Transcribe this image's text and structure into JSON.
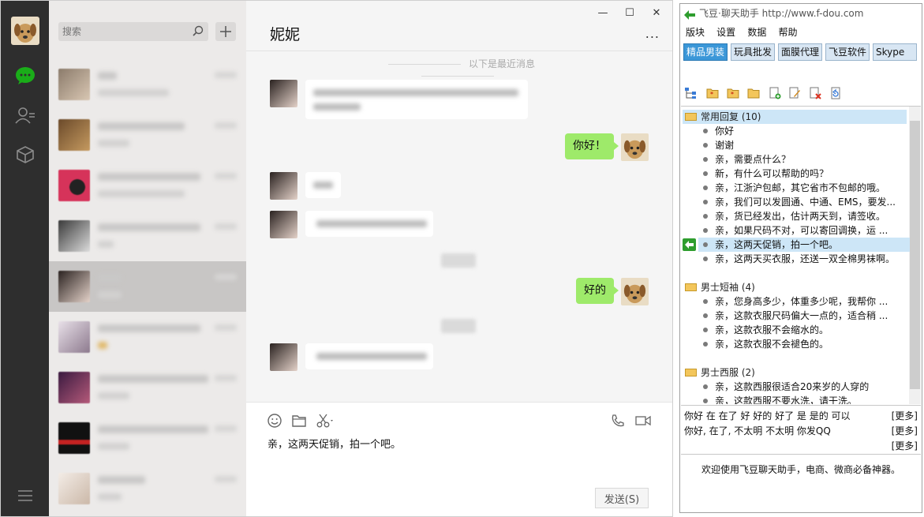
{
  "wechat": {
    "sidebar": {
      "icons": [
        "chat-icon",
        "contacts-icon",
        "favorites-icon",
        "menu-icon"
      ]
    },
    "search": {
      "placeholder": "搜索"
    },
    "chat": {
      "title": "妮妮",
      "more": "...",
      "history_divider": "以下是最近消息",
      "messages_out": [
        "你好！",
        "好的"
      ]
    },
    "composer": {
      "text": "亲，这两天促销，拍一个吧。",
      "send_label": "发送(S)"
    },
    "window_controls": [
      "—",
      "☐",
      "✕"
    ]
  },
  "fdou": {
    "title": "飞豆·聊天助手 http://www.f-dou.com",
    "menu": [
      "版块",
      "设置",
      "数据",
      "帮助"
    ],
    "tabs": [
      "精品男装",
      "玩具批发",
      "面膜代理",
      "飞豆软件",
      "Skype"
    ],
    "active_tab": "精品男装",
    "groups": [
      {
        "name": "常用回复 (10)",
        "items": [
          "你好",
          "谢谢",
          "亲，需要点什么？",
          "新，有什么可以帮助的吗？",
          "亲，江浙沪包邮，其它省市不包邮的哦。",
          "亲，我们可以发圆通、中通、EMS，要发...",
          "亲，货已经发出，估计两天到，请签收。",
          "亲，如果尺码不对，可以寄回调换，运 ...",
          "亲，这两天促销，拍一个吧。",
          "亲，这两天买衣服，还送一双全棉男袜啊。"
        ]
      },
      {
        "name": "男士短袖 (4)",
        "items": [
          "亲，您身高多少，体重多少呢，我帮你 ...",
          "亲，这款衣服尺码偏大一点的，适合稍 ...",
          "亲，这款衣服不会缩水的。",
          "亲，这款衣服不会褪色的。"
        ]
      },
      {
        "name": "男士西服 (2)",
        "items": [
          "亲，这款西服很适合20来岁的人穿的",
          "亲，这款西服不要水洗，请干洗。"
        ]
      }
    ],
    "quick_rows": [
      "你好  在  在了  好  好的  好了  是  是的  可以",
      "你好,    在了,    不太明   不太明   你发QQ"
    ],
    "more_label": "[更多]",
    "footer": "欢迎使用飞豆聊天助手，电商、微商必备神器。"
  },
  "colors": {
    "wechat_green": "#9eea6a",
    "sidebar_dark": "#2e2e2e",
    "tab_active": "#3b97d8",
    "selected_row": "#cde6f7"
  }
}
